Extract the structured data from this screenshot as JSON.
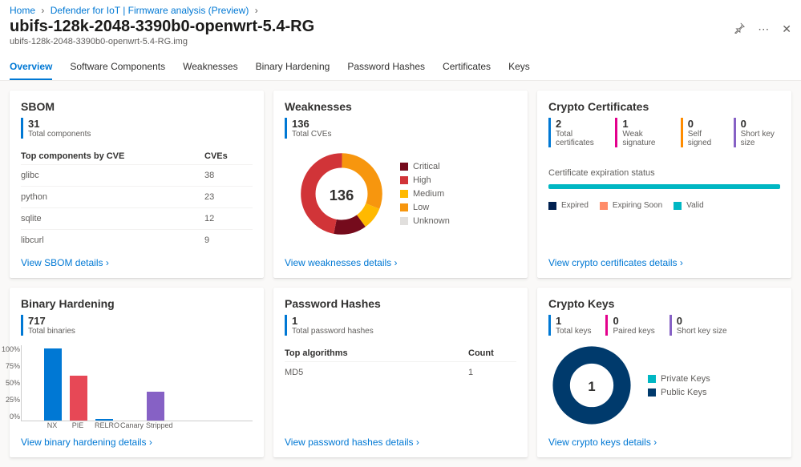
{
  "breadcrumb": {
    "home": "Home",
    "service": "Defender for IoT | Firmware analysis (Preview)"
  },
  "header": {
    "title": "ubifs-128k-2048-3390b0-openwrt-5.4-RG",
    "subtitle": "ubifs-128k-2048-3390b0-openwrt-5.4-RG.img"
  },
  "tabs": {
    "overview": "Overview",
    "software": "Software Components",
    "weaknesses": "Weaknesses",
    "binary": "Binary Hardening",
    "passwords": "Password Hashes",
    "certs": "Certificates",
    "keys": "Keys"
  },
  "sbom": {
    "title": "SBOM",
    "count": "31",
    "count_label": "Total components",
    "col1": "Top components by CVE",
    "col2": "CVEs",
    "rows": [
      {
        "name": "glibc",
        "cves": "38"
      },
      {
        "name": "python",
        "cves": "23"
      },
      {
        "name": "sqlite",
        "cves": "12"
      },
      {
        "name": "libcurl",
        "cves": "9"
      }
    ],
    "link": "View SBOM details"
  },
  "weak": {
    "title": "Weaknesses",
    "count": "136",
    "count_label": "Total CVEs",
    "center": "136",
    "legend": {
      "critical": "Critical",
      "high": "High",
      "medium": "Medium",
      "low": "Low",
      "unknown": "Unknown"
    },
    "link": "View weaknesses details"
  },
  "certs": {
    "title": "Crypto Certificates",
    "stats": [
      {
        "num": "2",
        "lbl": "Total certificates"
      },
      {
        "num": "1",
        "lbl": "Weak signature"
      },
      {
        "num": "0",
        "lbl": "Self signed"
      },
      {
        "num": "0",
        "lbl": "Short key size"
      }
    ],
    "exp_title": "Certificate expiration status",
    "legend": {
      "expired": "Expired",
      "soon": "Expiring Soon",
      "valid": "Valid"
    },
    "link": "View crypto certificates details"
  },
  "binary": {
    "title": "Binary Hardening",
    "count": "717",
    "count_label": "Total binaries",
    "ylabels": [
      "100%",
      "75%",
      "50%",
      "25%",
      "0%"
    ],
    "bars": [
      {
        "name": "NX",
        "pct": 100,
        "cls": "b-blue"
      },
      {
        "name": "PIE",
        "pct": 62,
        "cls": "b-red"
      },
      {
        "name": "RELRO",
        "pct": 2,
        "cls": "b-blue"
      },
      {
        "name": "Canary",
        "pct": 0,
        "cls": "b-blue"
      },
      {
        "name": "Stripped",
        "pct": 40,
        "cls": "b-purple"
      }
    ],
    "link": "View binary hardening details"
  },
  "pass": {
    "title": "Password Hashes",
    "count": "1",
    "count_label": "Total password hashes",
    "col1": "Top algorithms",
    "col2": "Count",
    "rows": [
      {
        "name": "MD5",
        "count": "1"
      }
    ],
    "link": "View password hashes details"
  },
  "keys": {
    "title": "Crypto Keys",
    "stats": [
      {
        "num": "1",
        "lbl": "Total keys"
      },
      {
        "num": "0",
        "lbl": "Paired keys"
      },
      {
        "num": "0",
        "lbl": "Short key size"
      }
    ],
    "center": "1",
    "legend": {
      "private": "Private Keys",
      "public": "Public Keys"
    },
    "link": "View crypto keys details"
  },
  "chart_data": [
    {
      "type": "pie",
      "title": "Weaknesses",
      "total": 136,
      "series": [
        {
          "name": "Critical",
          "value": 18,
          "color": "#750b1c"
        },
        {
          "name": "High",
          "value": 64,
          "color": "#d13438"
        },
        {
          "name": "Medium",
          "value": 12,
          "color": "#ffb900"
        },
        {
          "name": "Low",
          "value": 42,
          "color": "#f7960e"
        },
        {
          "name": "Unknown",
          "value": 0,
          "color": "#e1dfdd"
        }
      ]
    },
    {
      "type": "bar",
      "title": "Binary Hardening",
      "ylabel": "%",
      "ylim": [
        0,
        100
      ],
      "categories": [
        "NX",
        "PIE",
        "RELRO",
        "Canary",
        "Stripped"
      ],
      "values": [
        100,
        62,
        2,
        0,
        40
      ]
    },
    {
      "type": "bar",
      "title": "Certificate expiration status",
      "categories": [
        "Expired",
        "Expiring Soon",
        "Valid"
      ],
      "values": [
        0,
        0,
        2
      ]
    },
    {
      "type": "pie",
      "title": "Crypto Keys",
      "total": 1,
      "series": [
        {
          "name": "Private Keys",
          "value": 0,
          "color": "#00b7c3"
        },
        {
          "name": "Public Keys",
          "value": 1,
          "color": "#003a6c"
        }
      ]
    }
  ]
}
